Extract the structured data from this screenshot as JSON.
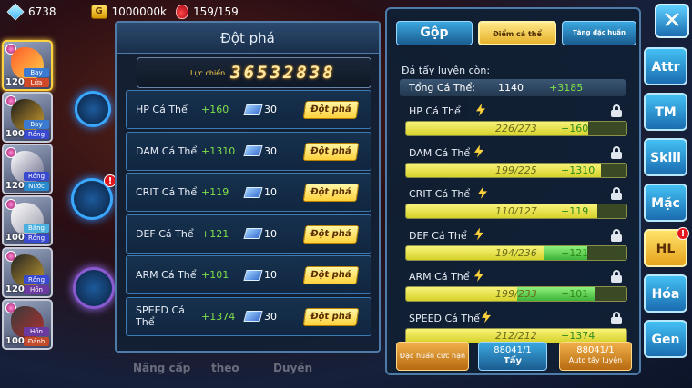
{
  "topbar": {
    "gems": "6738",
    "gold": "1000000k",
    "stamina": "159/159",
    "gold_symbol": "G"
  },
  "characters": [
    {
      "level": "120",
      "tags": [
        "Bay",
        "Lửa"
      ]
    },
    {
      "level": "100",
      "tags": [
        "Bay",
        "Rồng"
      ]
    },
    {
      "level": "120",
      "tags": [
        "Rồng",
        "Nước"
      ]
    },
    {
      "level": "100",
      "tags": [
        "Băng",
        "Rồng"
      ]
    },
    {
      "level": "120",
      "tags": [
        "Rồng",
        "Hồn"
      ]
    },
    {
      "level": "100",
      "tags": [
        "Hồn",
        "Đánh"
      ]
    }
  ],
  "left_panel": {
    "title": "Đột phá",
    "power_label": "Lực chiến",
    "power_value": "36532838",
    "breakthrough_label": "Đột phá",
    "rows": [
      {
        "name": "HP Cá Thể",
        "bonus": "+160",
        "cost": "30"
      },
      {
        "name": "DAM Cá Thể",
        "bonus": "+1310",
        "cost": "30"
      },
      {
        "name": "CRIT Cá Thể",
        "bonus": "+119",
        "cost": "10"
      },
      {
        "name": "DEF Cá Thể",
        "bonus": "+121",
        "cost": "10"
      },
      {
        "name": "ARM Cá Thể",
        "bonus": "+101",
        "cost": "10"
      },
      {
        "name": "SPEED Cá Thể",
        "bonus": "+1374",
        "cost": "30"
      }
    ]
  },
  "faded_labels": [
    "Nâng cấp",
    "theo",
    "Duyên"
  ],
  "right_panel": {
    "tabs": {
      "gop": "Gộp",
      "diem": "Điểm cá thể",
      "tang": "Tăng đặc huấn"
    },
    "remaining_label": "Đá tẩy luyện còn:",
    "total_label": "Tổng Cá Thể:",
    "total_value": "1140",
    "total_bonus": "+3185",
    "stats": [
      {
        "name": "HP Cá Thể",
        "value": "226/273",
        "bonus": "+160",
        "cur": 226,
        "max": 273
      },
      {
        "name": "DAM Cá Thể",
        "value": "199/225",
        "bonus": "+1310",
        "cur": 199,
        "max": 225
      },
      {
        "name": "CRIT Cá Thể",
        "value": "110/127",
        "bonus": "+119",
        "cur": 110,
        "max": 127
      },
      {
        "name": "DEF Cá Thể",
        "value": "194/236",
        "bonus": "+121",
        "cur": 194,
        "max": 236
      },
      {
        "name": "ARM Cá Thể",
        "value": "199/233",
        "bonus": "+101",
        "cur": 199,
        "max": 233
      },
      {
        "name": "SPEED Cá Thể",
        "value": "212/212",
        "bonus": "+1374",
        "cur": 212,
        "max": 212
      }
    ],
    "buttons": {
      "dac_huan": "Đặc huấn cực hạn",
      "tay_count": "88041/1",
      "tay_label": "Tẩy",
      "auto_count": "88041/1",
      "auto_label": "Auto tẩy luyện"
    }
  },
  "side_menu": {
    "close": "✕",
    "items": [
      "Attr",
      "TM",
      "Skill",
      "Mặc",
      "HL",
      "Hóa",
      "Gen"
    ]
  },
  "colors": {
    "accent_blue": "#3aa8e0",
    "gold": "#ffd23c",
    "bonus_green": "#7fe04a",
    "panel_border": "#4f7ba8"
  }
}
